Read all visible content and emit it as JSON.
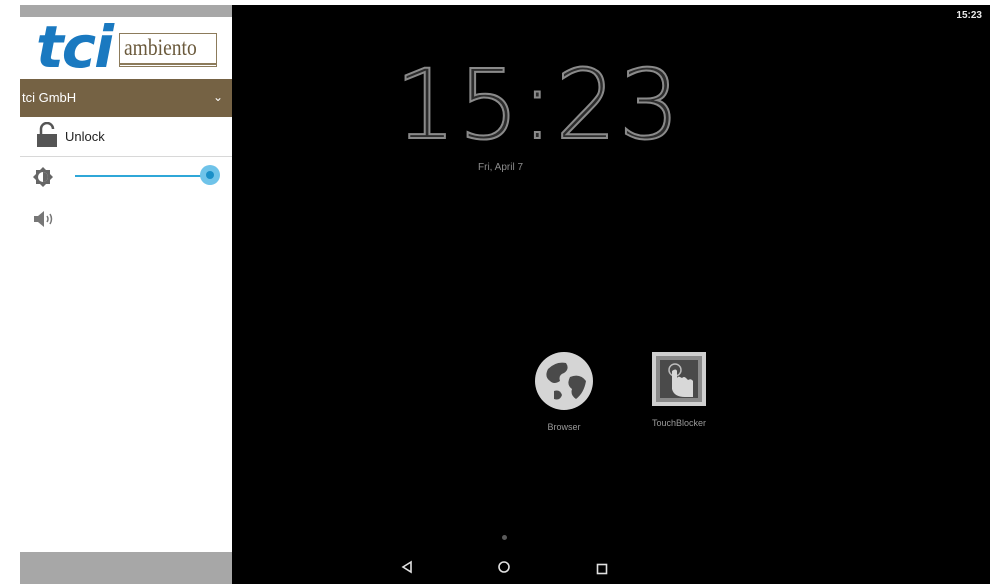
{
  "status_bar": {
    "time": "15:23"
  },
  "logo": {
    "primary": "tci",
    "secondary": "ambiento"
  },
  "drawer": {
    "account_name": "tci GmbH",
    "unlock_label": "Unlock",
    "brightness_level": 1.0
  },
  "lockscreen": {
    "clock": "15:23",
    "date": "Fri, April 7"
  },
  "apps": [
    {
      "label": "Browser",
      "icon": "globe-icon"
    },
    {
      "label": "TouchBlocker",
      "icon": "touch-hand-icon"
    }
  ],
  "colors": {
    "brand_blue": "#1a79c0",
    "brand_brown": "#756244",
    "accent": "#2fa7d8",
    "background": "#000000"
  }
}
